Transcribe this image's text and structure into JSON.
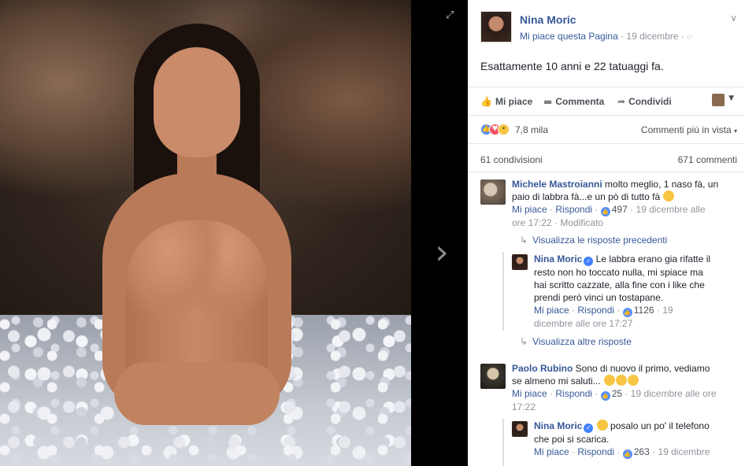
{
  "post": {
    "page_name": "Nina Moric",
    "like_page": "Mi piace questa Pagina",
    "sep": " · ",
    "date": "19 dicembre",
    "globe": "· ◌",
    "text": "Esattamente 10 anni e 22 tatuaggi fa.",
    "chevron": "∨"
  },
  "actions": {
    "like": "Mi piace",
    "comment": "Commenta",
    "share": "Condividi",
    "like_icon": "👍",
    "comment_icon": "▬",
    "share_icon": "➦",
    "dropdown": "▼"
  },
  "reactions": {
    "like_glyph": "👍",
    "love_glyph": "♥",
    "wow_glyph": "•",
    "count": "7,8 mila",
    "sort_label": "Commenti più in vista",
    "sort_caret": "▾"
  },
  "counts": {
    "shares": "61 condivisioni",
    "comments": "671 commenti"
  },
  "comments": [
    {
      "name": "Michele Mastroianni",
      "text": " molto meglio, 1 naso fà, un paio di labbra fà...e un pò di tutto fà",
      "like": "Mi piace",
      "reply": "Rispondi",
      "likes": "497",
      "time": "19 dicembre alle ore 17:22",
      "edited": "Modificato",
      "dot": " · "
    },
    {
      "name": "Nina Moric",
      "text": " Le labbra erano gia rifatte il resto non ho toccato nulla, mi spiace ma hai scritto cazzate, alla fine con i like che prendi però vinci un tostapane.",
      "like": "Mi piace",
      "reply": "Rispondi",
      "likes": "1126",
      "time": "19 dicembre alle ore 17:27",
      "dot": " · "
    },
    {
      "name": "Paolo Rubino",
      "text": " Sono di nuovo il primo, vediamo se almeno mi saluti...",
      "like": "Mi piace",
      "reply": "Rispondi",
      "likes": "25",
      "time": "19 dicembre alle ore 17:22",
      "dot": " · "
    },
    {
      "name": "Nina Moric",
      "text": " posalo un po' il telefono che poi si scarica.",
      "like": "Mi piace",
      "reply": "Rispondi",
      "likes": "263",
      "time": "19 dicembre",
      "dot": " · "
    }
  ],
  "reply_links": {
    "previous": "Visualizza le risposte precedenti",
    "more": "Visualizza altre risposte",
    "arrow": "↳"
  },
  "viewer": {
    "next_glyph": "›",
    "expand_glyph": "⤢",
    "verified_glyph": "✓",
    "like_mini_glyph": "👍"
  },
  "colors": {
    "link": "#365899",
    "meta": "#90949c",
    "like_blue": "#5890ff",
    "love_red": "#f25268",
    "wow_yellow": "#f7c542"
  }
}
